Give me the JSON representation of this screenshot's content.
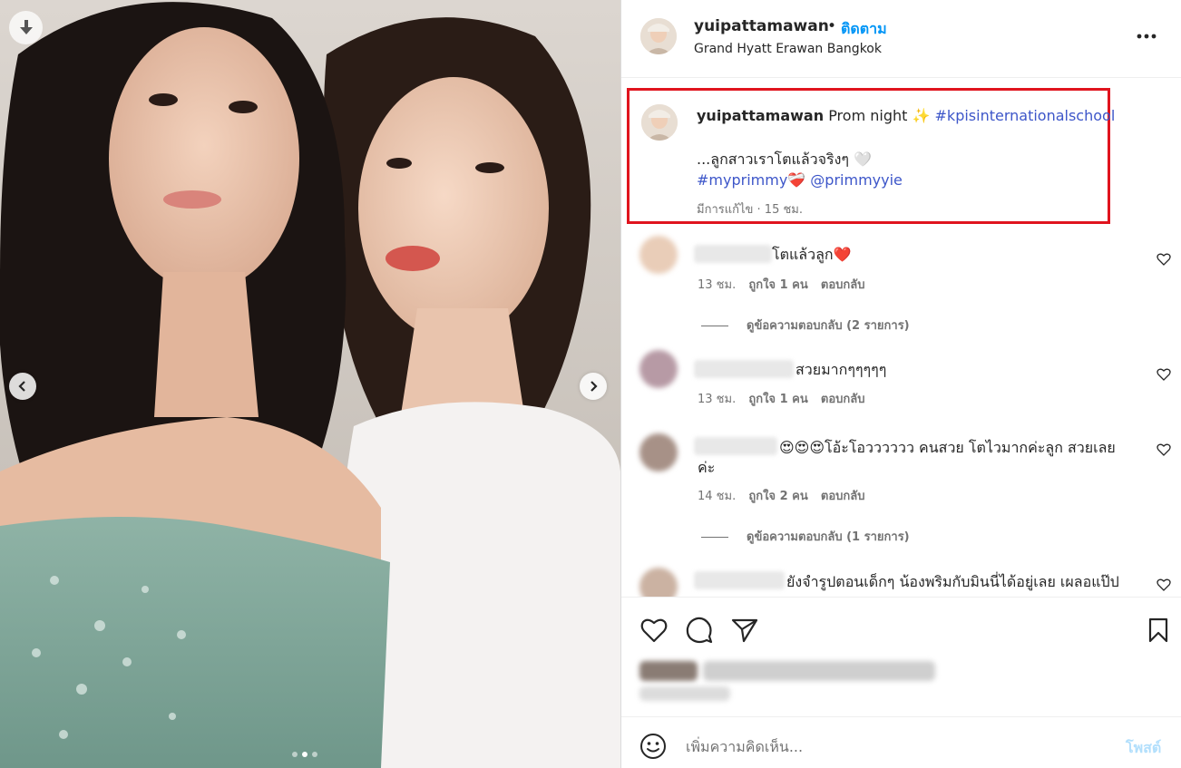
{
  "header": {
    "username": "yuipattamawan",
    "separator": "•",
    "follow_label": "ติดตาม",
    "location": "Grand Hyatt Erawan Bangkok"
  },
  "caption": {
    "username": "yuipattamawan",
    "text": "Prom night",
    "sparkle": "✨",
    "hashtag1": "#kpisinternationalschool",
    "line2": "...ลูกสาวเราโตแล้วจริงๆ",
    "line2_heart": "🤍",
    "hashtag2": "#myprimmy",
    "hashtag2_emoji": "❤️‍🩹",
    "mention": "@primmyyie",
    "meta": "มีการแก้ไข · 15 ชม."
  },
  "comments": [
    {
      "text": "โตแล้วลูก❤️",
      "time": "13 ชม.",
      "likes": "ถูกใจ 1 คน",
      "reply": "ตอบกลับ",
      "view_replies": "ดูข้อความตอบกลับ (2 รายการ)"
    },
    {
      "text": "สวยมากๆๆๆๆๆ",
      "time": "13 ชม.",
      "likes": "ถูกใจ 1 คน",
      "reply": "ตอบกลับ"
    },
    {
      "text": "😍😍😍โอ้ะโอวววววว คนสวย โตไวมากค่ะลูก สวยเลย",
      "text_cont": "ค่ะ",
      "time": "14 ชม.",
      "likes": "ถูกใจ 2 คน",
      "reply": "ตอบกลับ",
      "view_replies": "ดูข้อความตอบกลับ (1 รายการ)"
    },
    {
      "text": "ยังจำรูปตอนเด็กๆ น้องพริมกับมินนี่ได้อยู่เลย เผลอแป๊ป"
    }
  ],
  "add_comment": {
    "placeholder": "เพิ่มความคิดเห็น...",
    "post_label": "โพสต์"
  },
  "colors": {
    "link": "#3d56c9",
    "follow": "#0095f6",
    "highlight_border": "#e0141e",
    "post_disabled": "#b2dffc"
  },
  "icons": [
    "download-icon",
    "chevron-left-icon",
    "chevron-right-icon",
    "more-icon",
    "heart-icon",
    "comment-icon",
    "share-icon",
    "bookmark-icon",
    "emoji-icon"
  ],
  "carousel": {
    "slide_count": 3,
    "active_index": 1
  }
}
